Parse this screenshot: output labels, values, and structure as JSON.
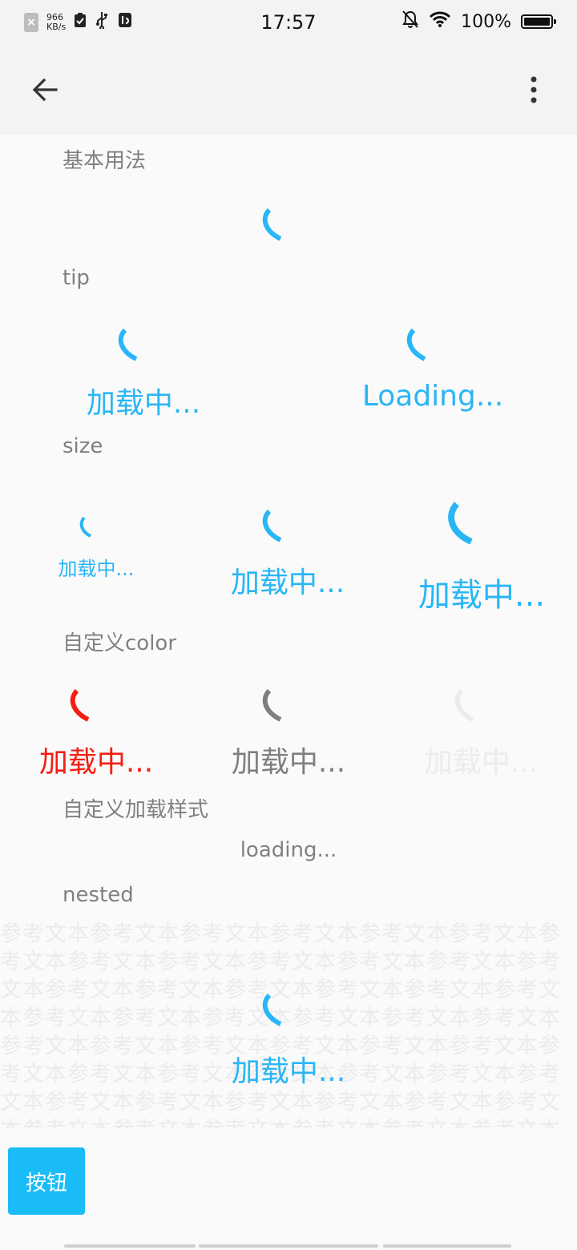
{
  "status_bar": {
    "time": "17:57",
    "net_speed_value": "966",
    "net_speed_unit": "KB/s",
    "battery_percent": "100%",
    "battery_level": 1.0
  },
  "app_bar": {
    "back_icon": "arrow-back-icon",
    "menu_icon": "more-vert-icon"
  },
  "sections": {
    "basic": {
      "title": "基本用法"
    },
    "tip": {
      "title": "tip",
      "items": [
        {
          "text": "加载中..."
        },
        {
          "text": "Loading..."
        }
      ]
    },
    "size": {
      "title": "size",
      "items": [
        {
          "text": "加载中..."
        },
        {
          "text": "加载中..."
        },
        {
          "text": "加载中..."
        }
      ]
    },
    "color": {
      "title": "自定义color",
      "items": [
        {
          "text": "加载中...",
          "color": "#f41e13"
        },
        {
          "text": "加载中...",
          "color": "#7f7f7f"
        },
        {
          "text": "加载中...",
          "color": "#ececec"
        }
      ]
    },
    "custom": {
      "title": "自定义加载样式",
      "text": "loading..."
    },
    "nested": {
      "title": "nested",
      "background_text": "参考文本参考文本参考文本参考文本参考文本参考文本参考文本参考文本参考文本参考文本参考文本参考文本参考文本参考文本参考文本参考文本参考文本参考文本参考文本参考文本参考文本参考文本参考文本参考文本参考文本参考文本参考文本参考文本参考文本参考文本参考文本参考文本参考文本参考文本参考文本参考文本参考文本参考文本参考文本参考文本参考文本参考文本参考文本参考文本参考文本参考文本参考文本参考文本参考文本参考文本",
      "tip": "加载中...",
      "button_label": "按钮"
    }
  },
  "colors": {
    "primary": "#29b6f6",
    "button": "#1abcf8",
    "text_gray": "#808080"
  }
}
